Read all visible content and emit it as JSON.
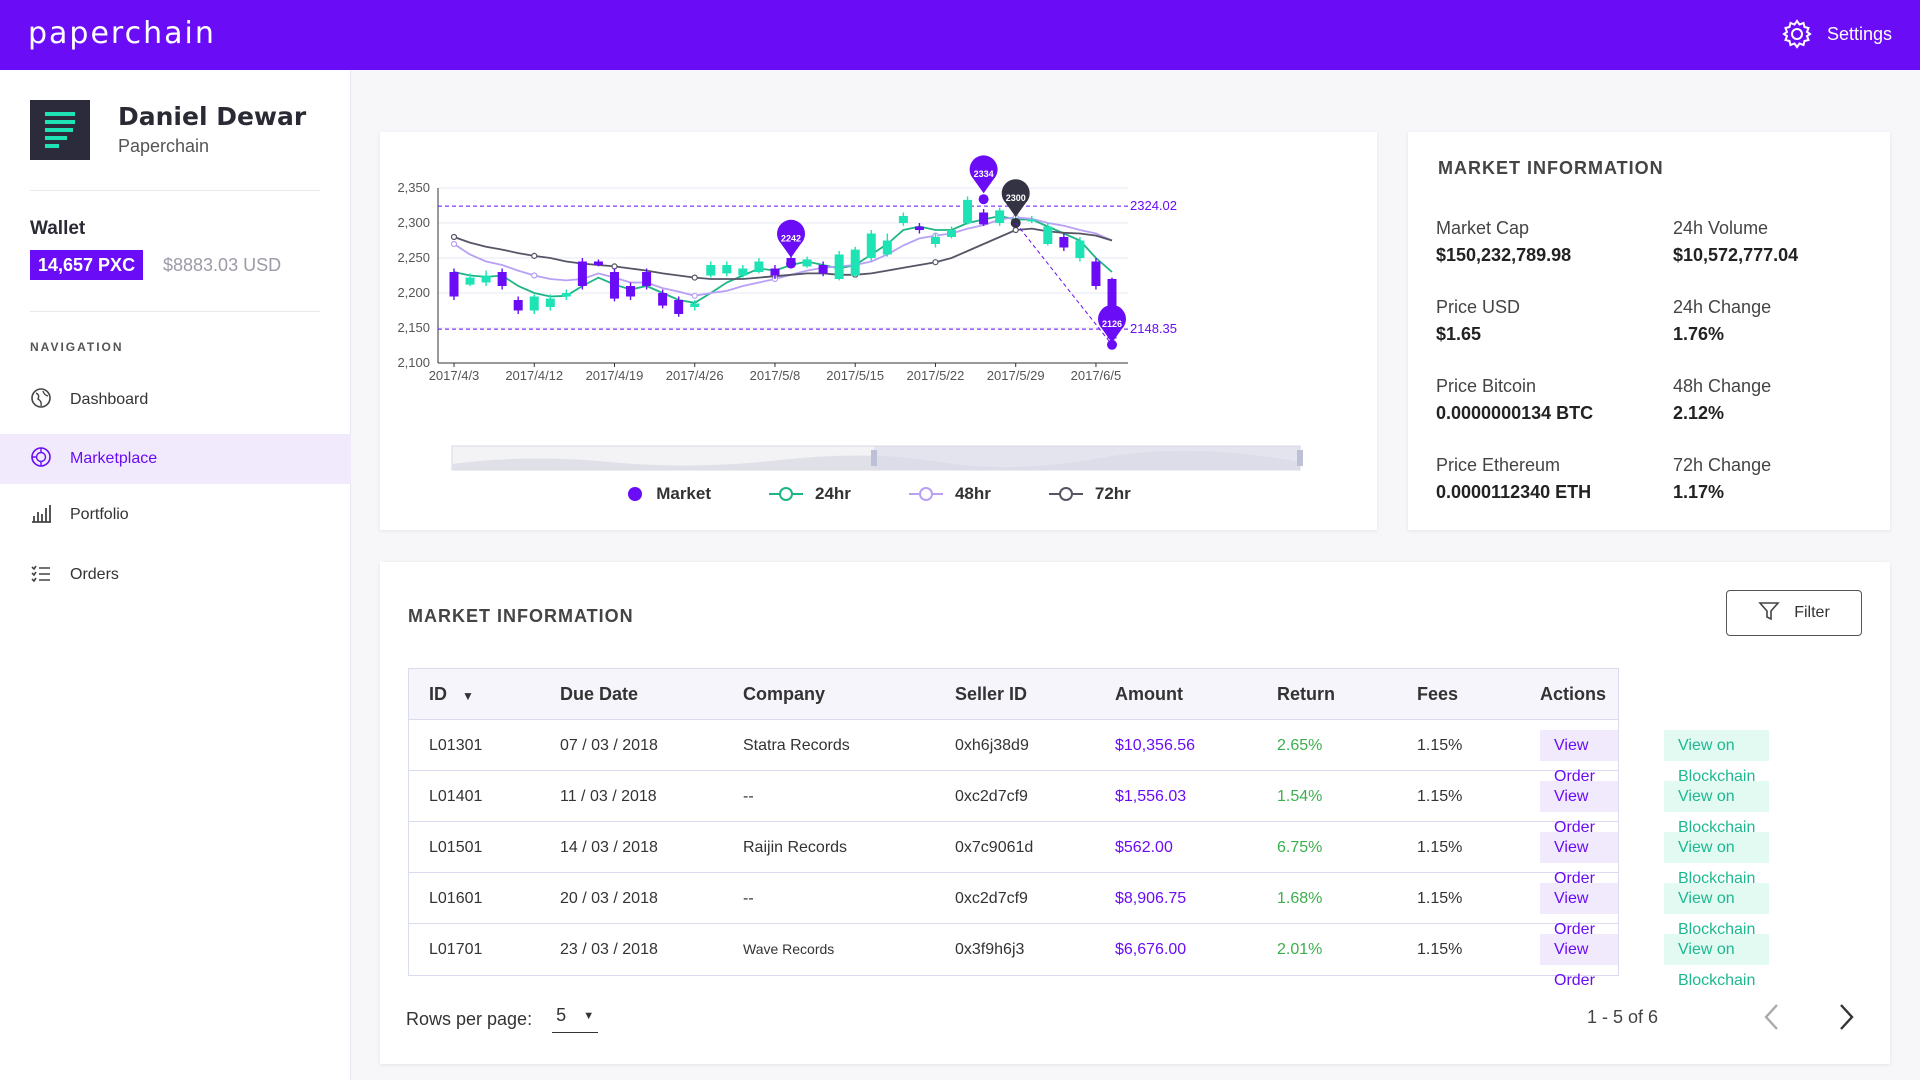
{
  "app": {
    "brand": "paperchain",
    "settings_label": "Settings"
  },
  "user": {
    "name": "Daniel Dewar",
    "org": "Paperchain"
  },
  "wallet": {
    "title": "Wallet",
    "balance": "14,657 PXC",
    "usd": "$8883.03 USD"
  },
  "nav": {
    "title": "NAVIGATION",
    "items": [
      {
        "label": "Dashboard",
        "icon": "globe-icon",
        "active": false
      },
      {
        "label": "Marketplace",
        "icon": "marketplace-icon",
        "active": true
      },
      {
        "label": "Portfolio",
        "icon": "bar-chart-icon",
        "active": false
      },
      {
        "label": "Orders",
        "icon": "list-icon",
        "active": false
      }
    ]
  },
  "colors": {
    "brand": "#6a0cf5",
    "up": "#1de3b5",
    "line24": "#1db585",
    "line48": "#b8a0f5",
    "line72": "#555566",
    "ret": "#3caf4d"
  },
  "chart_data": {
    "type": "candlestick",
    "x_ticks": [
      "2017/4/3",
      "2017/4/12",
      "2017/4/19",
      "2017/4/26",
      "2017/5/8",
      "2017/5/15",
      "2017/5/22",
      "2017/5/29",
      "2017/6/5"
    ],
    "y_ticks": [
      "2,350",
      "2,300",
      "2,250",
      "2,200",
      "2,150",
      "2,100"
    ],
    "ylim": [
      2100,
      2350
    ],
    "markline_values": [
      "2324.02",
      "2148.35"
    ],
    "markers": [
      {
        "label": "2334",
        "value": 2334,
        "index": 33
      },
      {
        "label": "2300",
        "value": 2300,
        "index": 35
      },
      {
        "label": "2242",
        "value": 2242,
        "index": 21
      },
      {
        "label": "2126",
        "value": 2126,
        "index": 41
      }
    ],
    "series": [
      {
        "name": "Market",
        "open": [
          2230,
          2212,
          2215,
          2230,
          2190,
          2175,
          2180,
          2195,
          2245,
          2245,
          2230,
          2210,
          2230,
          2200,
          2190,
          2180,
          2225,
          2228,
          2225,
          2230,
          2235,
          2250,
          2238,
          2240,
          2220,
          2225,
          2250,
          2255,
          2300,
          2295,
          2270,
          2280,
          2300,
          2315,
          2300,
          2298,
          2305,
          2270,
          2280,
          2250,
          2245,
          2220
        ],
        "close": [
          2195,
          2222,
          2225,
          2210,
          2175,
          2195,
          2192,
          2200,
          2210,
          2240,
          2192,
          2195,
          2210,
          2182,
          2170,
          2185,
          2240,
          2240,
          2235,
          2245,
          2225,
          2240,
          2248,
          2228,
          2255,
          2262,
          2285,
          2275,
          2310,
          2290,
          2280,
          2290,
          2333,
          2298,
          2318,
          2305,
          2305,
          2295,
          2265,
          2275,
          2210,
          2135
        ],
        "high": [
          2235,
          2228,
          2232,
          2235,
          2195,
          2198,
          2198,
          2205,
          2250,
          2248,
          2235,
          2215,
          2235,
          2205,
          2195,
          2190,
          2245,
          2245,
          2240,
          2250,
          2240,
          2255,
          2252,
          2245,
          2260,
          2266,
          2290,
          2285,
          2315,
          2300,
          2285,
          2295,
          2338,
          2320,
          2322,
          2310,
          2310,
          2300,
          2285,
          2280,
          2250,
          2222
        ],
        "low": [
          2190,
          2210,
          2210,
          2205,
          2170,
          2170,
          2175,
          2190,
          2205,
          2238,
          2188,
          2190,
          2205,
          2178,
          2166,
          2175,
          2222,
          2224,
          2222,
          2228,
          2220,
          2235,
          2236,
          2224,
          2218,
          2222,
          2246,
          2252,
          2296,
          2285,
          2265,
          2278,
          2298,
          2296,
          2296,
          2296,
          2300,
          2268,
          2260,
          2245,
          2205,
          2128
        ]
      },
      {
        "name": "24hr",
        "values": [
          2230,
          2225,
          2223,
          2225,
          2210,
          2200,
          2195,
          2196,
          2210,
          2222,
          2212,
          2205,
          2210,
          2200,
          2190,
          2186,
          2200,
          2215,
          2225,
          2235,
          2232,
          2240,
          2245,
          2240,
          2235,
          2240,
          2255,
          2270,
          2290,
          2295,
          2290,
          2290,
          2300,
          2305,
          2310,
          2305,
          2305,
          2295,
          2285,
          2275,
          2250,
          2230
        ]
      },
      {
        "name": "48hr",
        "values": [
          2270,
          2255,
          2245,
          2240,
          2232,
          2225,
          2220,
          2218,
          2220,
          2228,
          2222,
          2215,
          2215,
          2207,
          2202,
          2196,
          2200,
          2203,
          2210,
          2215,
          2220,
          2226,
          2232,
          2236,
          2238,
          2240,
          2245,
          2255,
          2268,
          2278,
          2282,
          2285,
          2292,
          2297,
          2305,
          2308,
          2306,
          2300,
          2296,
          2290,
          2285,
          2275
        ]
      },
      {
        "name": "72hr",
        "values": [
          2280,
          2272,
          2266,
          2262,
          2257,
          2253,
          2250,
          2245,
          2242,
          2240,
          2238,
          2235,
          2232,
          2228,
          2225,
          2222,
          2220,
          2220,
          2220,
          2222,
          2224,
          2226,
          2228,
          2228,
          2226,
          2226,
          2228,
          2232,
          2236,
          2240,
          2244,
          2250,
          2260,
          2270,
          2280,
          2290,
          2292,
          2288,
          2286,
          2285,
          2282,
          2275
        ]
      }
    ]
  },
  "market_info": {
    "title": "MARKET INFORMATION",
    "cells": [
      {
        "label": "Market Cap",
        "value": "$150,232,789.98"
      },
      {
        "label": "24h Volume",
        "value": "$10,572,777.04"
      },
      {
        "label": "Price USD",
        "value": "$1.65"
      },
      {
        "label": "24h Change",
        "value": "1.76%"
      },
      {
        "label": "Price Bitcoin",
        "value": "0.0000000134 BTC"
      },
      {
        "label": "48h Change",
        "value": "2.12%"
      },
      {
        "label": "Price Ethereum",
        "value": "0.0000112340 ETH"
      },
      {
        "label": "72h Change",
        "value": "1.17%"
      }
    ]
  },
  "table": {
    "title": "MARKET INFORMATION",
    "filter_label": "Filter",
    "headers": [
      "ID",
      "Due Date",
      "Company",
      "Seller ID",
      "Amount",
      "Return",
      "Fees",
      "Actions"
    ],
    "rows": [
      {
        "id": "L01301",
        "due": "07 / 03 / 2018",
        "company": "Statra Records",
        "seller": "0xh6j38d9",
        "amount": "$10,356.56",
        "ret": "2.65%",
        "fees": "1.15%",
        "view_order": "View Order",
        "view_chain": "View on Blockchain"
      },
      {
        "id": "L01401",
        "due": "11 / 03 / 2018",
        "company": "--",
        "seller": "0xc2d7cf9",
        "amount": "$1,556.03",
        "ret": "1.54%",
        "fees": "1.15%",
        "view_order": "View Order",
        "view_chain": "View on Blockchain"
      },
      {
        "id": "L01501",
        "due": "14 / 03 / 2018",
        "company": "Raijin Records",
        "seller": "0x7c9061d",
        "amount": "$562.00",
        "ret": "6.75%",
        "fees": "1.15%",
        "view_order": "View Order",
        "view_chain": "View on Blockchain"
      },
      {
        "id": "L01601",
        "due": "20 / 03 / 2018",
        "company": "--",
        "seller": "0xc2d7cf9",
        "amount": "$8,906.75",
        "ret": "1.68%",
        "fees": "1.15%",
        "view_order": "View Order",
        "view_chain": "View on Blockchain"
      },
      {
        "id": "L01701",
        "due": "23 / 03 / 2018",
        "company": "Wave Records",
        "seller": "0x3f9h6j3",
        "amount": "$6,676.00",
        "ret": "2.01%",
        "fees": "1.15%",
        "view_order": "View Order",
        "view_chain": "View on Blockchain"
      }
    ],
    "rows_per_page_label": "Rows per page:",
    "rows_per_page": "5",
    "range": "1 - 5 of 6"
  }
}
